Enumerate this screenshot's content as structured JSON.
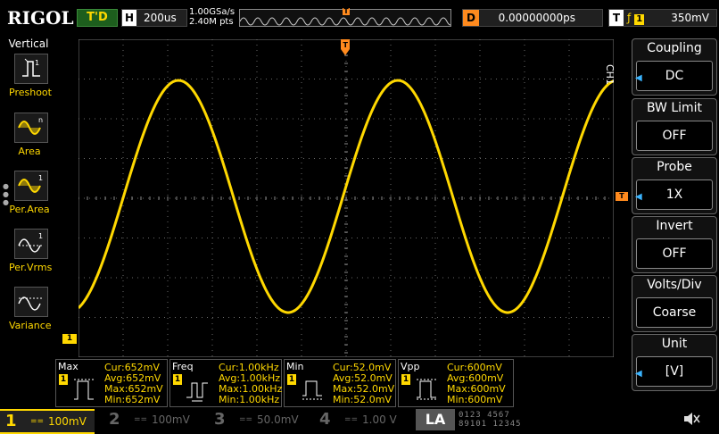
{
  "top": {
    "brand": "RIGOL",
    "trigger_status": "T'D",
    "horizontal_label": "H",
    "timebase": "200us",
    "sample_rate": "1.00GSa/s",
    "memory_depth": "2.40M pts",
    "delay_label": "D",
    "delay_value": "0.00000000ps",
    "trigger_label": "T",
    "trigger_source": "1",
    "trigger_level": "350mV",
    "memory_marker": "T"
  },
  "left_menu": {
    "title": "Vertical",
    "items": [
      {
        "label": "Preshoot",
        "icon": "preshoot-icon"
      },
      {
        "label": "Area",
        "icon": "area-icon"
      },
      {
        "label": "Per.Area",
        "icon": "per-area-icon"
      },
      {
        "label": "Per.Vrms",
        "icon": "per-vrms-icon"
      },
      {
        "label": "Variance",
        "icon": "variance-icon"
      }
    ]
  },
  "waveform": {
    "channel": "1",
    "color": "#ffd800",
    "trigger_marker": "T"
  },
  "measurements": [
    {
      "name": "Max",
      "ch": "1",
      "cur": "Cur:652mV",
      "avg": "Avg:652mV",
      "max": "Max:652mV",
      "min": "Min:652mV"
    },
    {
      "name": "Freq",
      "ch": "1",
      "cur": "Cur:1.00kHz",
      "avg": "Avg:1.00kHz",
      "max": "Max:1.00kHz",
      "min": "Min:1.00kHz"
    },
    {
      "name": "Min",
      "ch": "1",
      "cur": "Cur:52.0mV",
      "avg": "Avg:52.0mV",
      "max": "Max:52.0mV",
      "min": "Min:52.0mV"
    },
    {
      "name": "Vpp",
      "ch": "1",
      "cur": "Cur:600mV",
      "avg": "Avg:600mV",
      "max": "Max:600mV",
      "min": "Min:600mV"
    }
  ],
  "channels": [
    {
      "num": "1",
      "coupling": "==",
      "scale": "100mV"
    },
    {
      "num": "2",
      "coupling": "==",
      "scale": "100mV"
    },
    {
      "num": "3",
      "coupling": "==",
      "scale": "50.0mV"
    },
    {
      "num": "4",
      "coupling": "==",
      "scale": "1.00 V"
    }
  ],
  "la": {
    "label": "LA",
    "bits_top": "0123 4567",
    "bits_bottom": "89101 12345"
  },
  "right_panel": {
    "channel_label": "CH1",
    "buttons": [
      {
        "title": "Coupling",
        "value": "DC"
      },
      {
        "title": "BW Limit",
        "value": "OFF"
      },
      {
        "title": "Probe",
        "value": "1X"
      },
      {
        "title": "Invert",
        "value": "OFF"
      },
      {
        "title": "Volts/Div",
        "value": "Coarse"
      },
      {
        "title": "Unit",
        "value": "[V]"
      }
    ]
  }
}
